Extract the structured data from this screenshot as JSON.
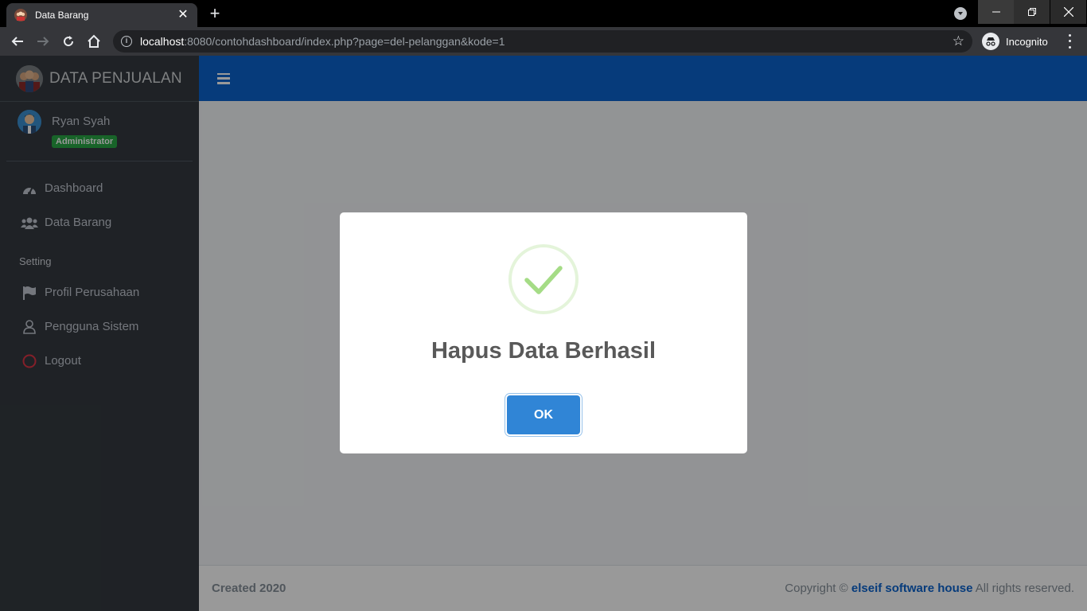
{
  "browser": {
    "tab_title": "Data Barang",
    "tab_close": "✕",
    "new_tab": "+",
    "url_host": "localhost",
    "url_rest": ":8080/contohdashboard/index.php?page=del-pelanggan&kode=1",
    "incognito_label": "Incognito"
  },
  "sidebar": {
    "brand": "DATA PENJUALAN",
    "user_name": "Ryan Syah",
    "user_role": "Administrator",
    "items": [
      {
        "label": "Dashboard",
        "icon": "tachometer-icon"
      },
      {
        "label": "Data Barang",
        "icon": "users-icon"
      }
    ],
    "setting_header": "Setting",
    "setting_items": [
      {
        "label": "Profil Perusahaan",
        "icon": "flag-icon"
      },
      {
        "label": "Pengguna Sistem",
        "icon": "user-icon"
      },
      {
        "label": "Logout",
        "icon": "circle-icon"
      }
    ]
  },
  "footer": {
    "created": "Created 2020",
    "copyright_prefix": "Copyright ©",
    "company": "elseif software house",
    "rights": "All rights reserved."
  },
  "modal": {
    "title": "Hapus Data Berhasil",
    "ok_label": "OK",
    "icon": "success-check-icon"
  },
  "colors": {
    "topbar": "#0b63ce",
    "sidebar": "#343a40",
    "badge": "#28a745",
    "ok_button": "#3085d6",
    "success": "#a5dc86"
  }
}
